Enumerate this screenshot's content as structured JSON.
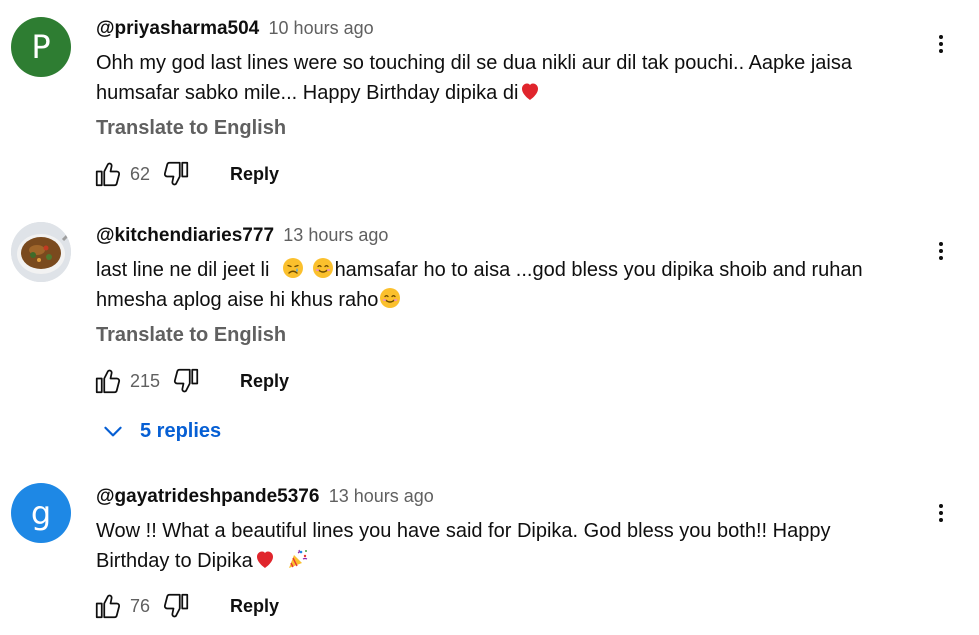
{
  "comments": [
    {
      "avatar_letter": "P",
      "avatar_color": "#2e7d32",
      "author": "@priyasharma504",
      "time": "10 hours ago",
      "text_line1": "Ohh my god last lines were so touching dil se dua nikli aur dil tak pouchi.. Aapke jaisa",
      "text_line2": "humsafar sabko mile... Happy Birthday dipika di",
      "translate": "Translate to English",
      "likes": "62",
      "reply": "Reply"
    },
    {
      "author": "@kitchendiaries777",
      "time": "13 hours ago",
      "text_line1a": "last line ne dil jeet li",
      "text_line1b": "hamsafar ho to aisa ...god bless you dipika shoib and ruhan",
      "text_line2": "hmesha aplog aise hi khus raho",
      "translate": "Translate to English",
      "likes": "215",
      "reply": "Reply",
      "replies": "5 replies"
    },
    {
      "avatar_letter": "g",
      "avatar_color": "#1e88e5",
      "author": "@gayatrideshpande5376",
      "time": "13 hours ago",
      "text_line1": "Wow !! What a beautiful lines you have said for Dipika. God bless you both!! Happy",
      "text_line2": "Birthday to Dipika",
      "likes": "76",
      "reply": "Reply"
    }
  ],
  "icons": {
    "like": "thumbs-up-icon",
    "dislike": "thumbs-down-icon",
    "menu": "more-vert-icon",
    "expand": "chevron-down-icon"
  }
}
